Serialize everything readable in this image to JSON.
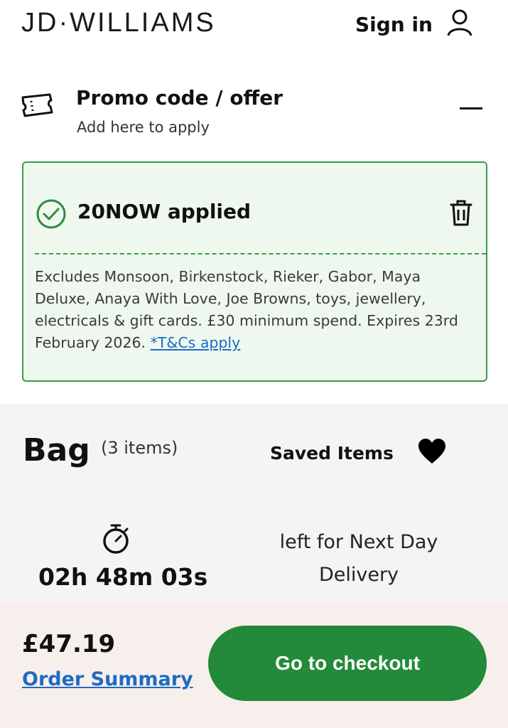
{
  "header": {
    "logo": "JD·WILLIAMS",
    "sign_in_label": "Sign in"
  },
  "promo": {
    "title": "Promo code / offer",
    "subtitle": "Add here to apply"
  },
  "applied": {
    "title": "20NOW applied",
    "terms_text": "Excludes Monsoon, Birkenstock, Rieker, Gabor, Maya Deluxe, Anaya With Love, Joe Browns, toys, jewellery, electricals & gift cards. £30 minimum spend. Expires 23rd February 2026. ",
    "terms_link": "*T&Cs apply"
  },
  "bag": {
    "title": "Bag",
    "count": "(3 items)",
    "saved_label": "Saved Items",
    "countdown": "02h 48m 03s",
    "next_day": "left for Next Day Delivery"
  },
  "footer": {
    "price": "£47.19",
    "order_summary": "Order Summary",
    "checkout_label": "Go to checkout"
  },
  "colors": {
    "accent_green": "#228a38",
    "applied_bg": "#eef8ef",
    "link_blue": "#1f6bc2",
    "footer_bg": "#f6efec"
  },
  "icons": [
    "user-icon",
    "ticket-icon",
    "minus-icon",
    "check-circle-icon",
    "trash-icon",
    "heart-icon",
    "stopwatch-icon"
  ]
}
